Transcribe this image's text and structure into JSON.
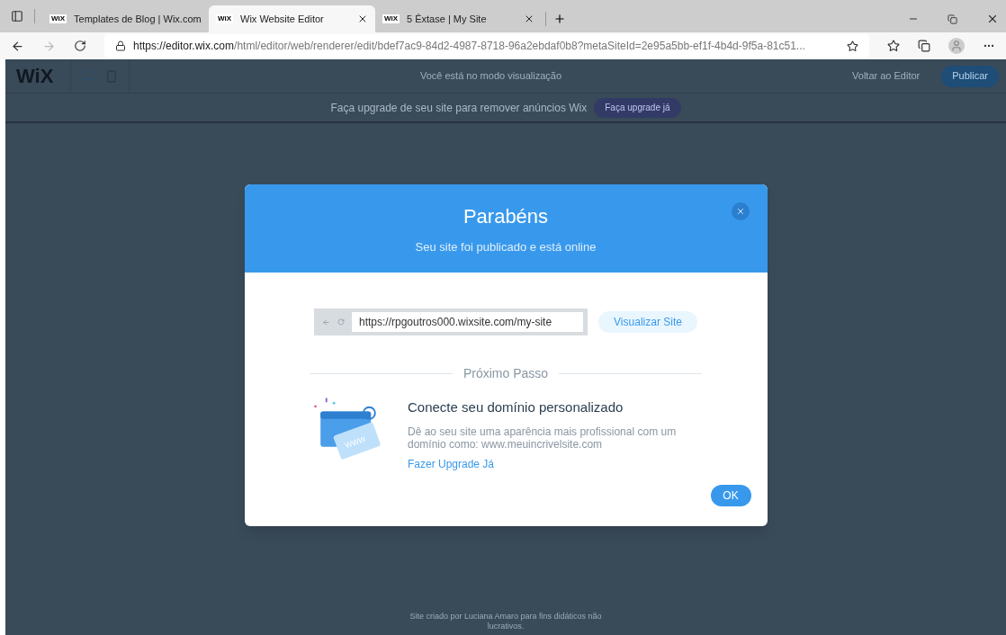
{
  "browser": {
    "tabs": [
      {
        "title": "Templates de Blog | Wix.com",
        "favicon": "WiX",
        "selected": false
      },
      {
        "title": "Wix Website Editor",
        "favicon": "WiX",
        "selected": true
      },
      {
        "title": "5 Êxtase | My Site",
        "favicon": "WiX",
        "selected": false
      }
    ],
    "address": {
      "host": "https://editor.wix.com",
      "path": "/html/editor/web/renderer/edit/bdef7ac9-84d2-4987-8718-96a2ebdaf0b8?metaSiteId=2e95a5bb-ef1f-4b4d-9f5a-81c51..."
    }
  },
  "editor_bar": {
    "logo": "WiX",
    "preview_notice": "Você está no modo visualização",
    "back_link": "Voltar ao Editor",
    "publish_button": "Publicar"
  },
  "upgrade_bar": {
    "text": "Faça upgrade de seu site para remover anúncios Wix",
    "button": "Faça upgrade já"
  },
  "footer_text": "Site criado por Luciana Amaro para fins didáticos não lucrativos.",
  "modal": {
    "title": "Parabéns",
    "subtitle": "Seu site foi publicado e está online",
    "url": "https://rpgoutros000.wixsite.com/my-site",
    "view_button": "Visualizar Site",
    "divider_label": "Próximo Passo",
    "step_title": "Conecte seu domínio personalizado",
    "step_text": "Dê ao seu site uma aparência mais profissional com um domínio como: www.meuincrivelsite.com",
    "step_link": "Fazer Upgrade Já",
    "illustration_text": "WWW",
    "ok_button": "OK"
  }
}
